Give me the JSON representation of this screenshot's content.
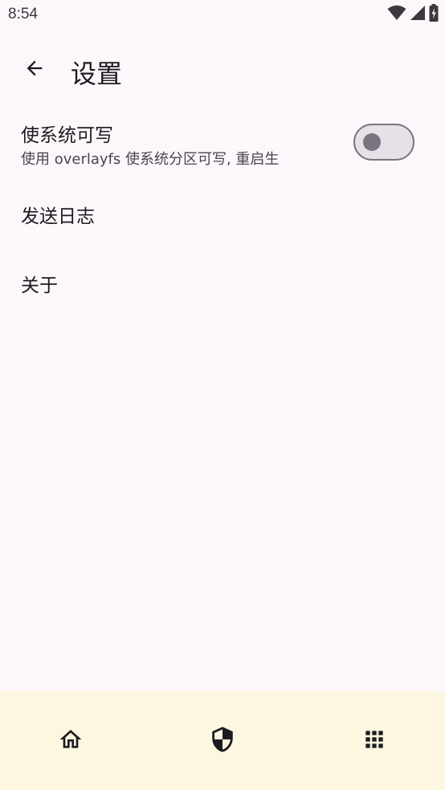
{
  "status_bar": {
    "time": "8:54",
    "icons": [
      "wifi-icon",
      "signal-icon",
      "battery-charging-icon"
    ]
  },
  "app_bar": {
    "title": "设置",
    "back_icon": "arrow-back-icon"
  },
  "settings": {
    "overlay": {
      "title": "使系统可写",
      "subtitle": "使用 overlayfs 使系统分区可写, 重启生",
      "enabled": false
    },
    "send_logs": {
      "title": "发送日志"
    },
    "about": {
      "title": "关于"
    }
  },
  "bottom_nav": {
    "items": [
      {
        "icon": "home-icon"
      },
      {
        "icon": "shield-icon"
      },
      {
        "icon": "apps-grid-icon"
      }
    ]
  },
  "colors": {
    "background": "#fdf7fb",
    "nav_background": "#fdf6e0",
    "text_primary": "#1d1b20",
    "text_secondary": "#49454f",
    "switch_outline": "#79747e",
    "switch_track": "#e6e0e9"
  }
}
